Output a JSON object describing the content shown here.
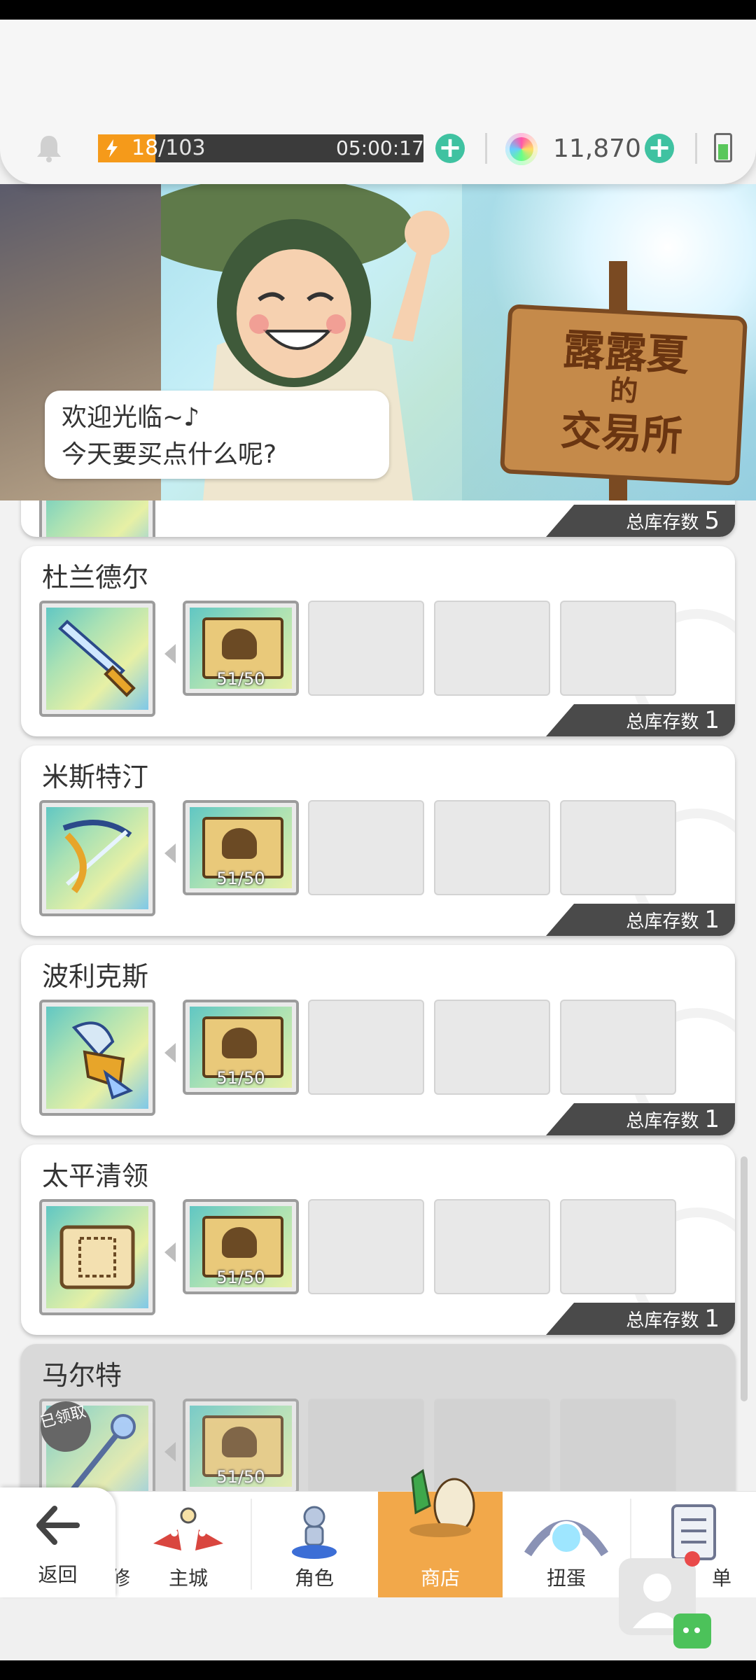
{
  "header": {
    "energy_current": "18",
    "energy_max": "/103",
    "energy_timer": "05:00:17",
    "gem_count": "11,870"
  },
  "banner": {
    "speech_line1": "欢迎光临~♪",
    "speech_line2": "今天要买点什么呢?",
    "sign_line1": "露露夏",
    "sign_line2": "的",
    "sign_line3": "交易所"
  },
  "stock_label": "总库存数",
  "top_partial_stock": "5",
  "cards": [
    {
      "name": "杜兰德尔",
      "material_count": "51/50",
      "stock": "1"
    },
    {
      "name": "米斯特汀",
      "material_count": "51/50",
      "stock": "1"
    },
    {
      "name": "波利克斯",
      "material_count": "51/50",
      "stock": "1"
    },
    {
      "name": "太平清领",
      "material_count": "51/50",
      "stock": "1"
    },
    {
      "name": "马尔特",
      "material_count": "51/50",
      "badge": "已领取"
    }
  ],
  "nav": {
    "back": "返回",
    "back_hidden_char": "修",
    "items": [
      "主城",
      "角色",
      "商店",
      "扭蛋",
      "单"
    ],
    "active": "商店"
  },
  "colors": {
    "accent": "#3fc2a1",
    "nav_active": "#f2a84a",
    "stock_bar": "#4a4a4a",
    "energy_fill": "#f59a1a"
  }
}
